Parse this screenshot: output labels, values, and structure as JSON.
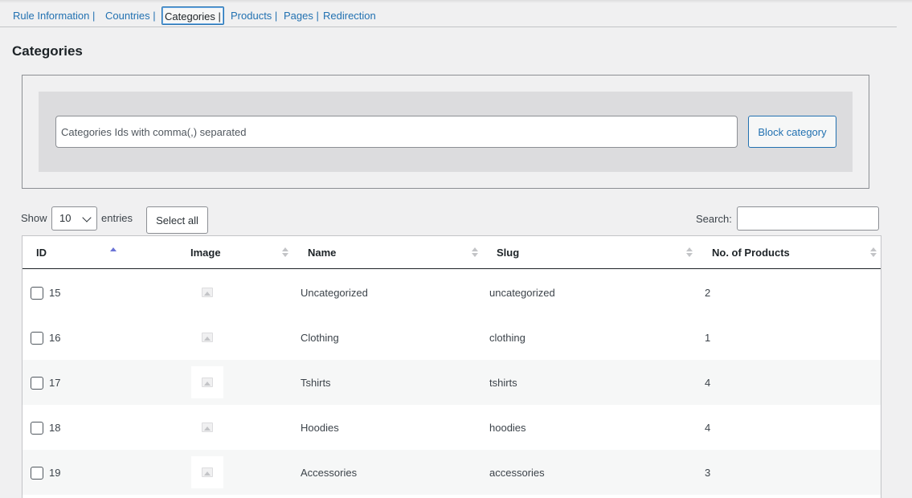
{
  "tabs": [
    {
      "label": "Rule Information |",
      "active": false
    },
    {
      "label": "Countries |",
      "active": false
    },
    {
      "label": "Categories |",
      "active": true
    },
    {
      "label": "Products |",
      "active": false
    },
    {
      "label": "Pages |",
      "active": false
    },
    {
      "label": "Redirection",
      "active": false
    }
  ],
  "section_title": "Categories",
  "block_form": {
    "input_placeholder": "Categories Ids with comma(,) separated",
    "button_label": "Block category"
  },
  "controls": {
    "show_label": "Show",
    "entries_value": "10",
    "entries_label": "entries",
    "select_all_label": "Select all",
    "search_label": "Search:"
  },
  "table": {
    "columns": [
      "ID",
      "Image",
      "Name",
      "Slug",
      "No. of Products"
    ],
    "rows": [
      {
        "id": "15",
        "name": "Uncategorized",
        "slug": "uncategorized",
        "count": "2"
      },
      {
        "id": "16",
        "name": "Clothing",
        "slug": "clothing",
        "count": "1"
      },
      {
        "id": "17",
        "name": "Tshirts",
        "slug": "tshirts",
        "count": "4"
      },
      {
        "id": "18",
        "name": "Hoodies",
        "slug": "hoodies",
        "count": "4"
      },
      {
        "id": "19",
        "name": "Accessories",
        "slug": "accessories",
        "count": "3"
      }
    ]
  },
  "colors": {
    "link": "#2271b1",
    "background": "#f0f0f1",
    "sort_active": "#6b73d6"
  },
  "icons": {
    "image_placeholder": "image-placeholder-icon",
    "sort": "sort-arrows-icon",
    "dropdown": "chevron-down-icon"
  }
}
